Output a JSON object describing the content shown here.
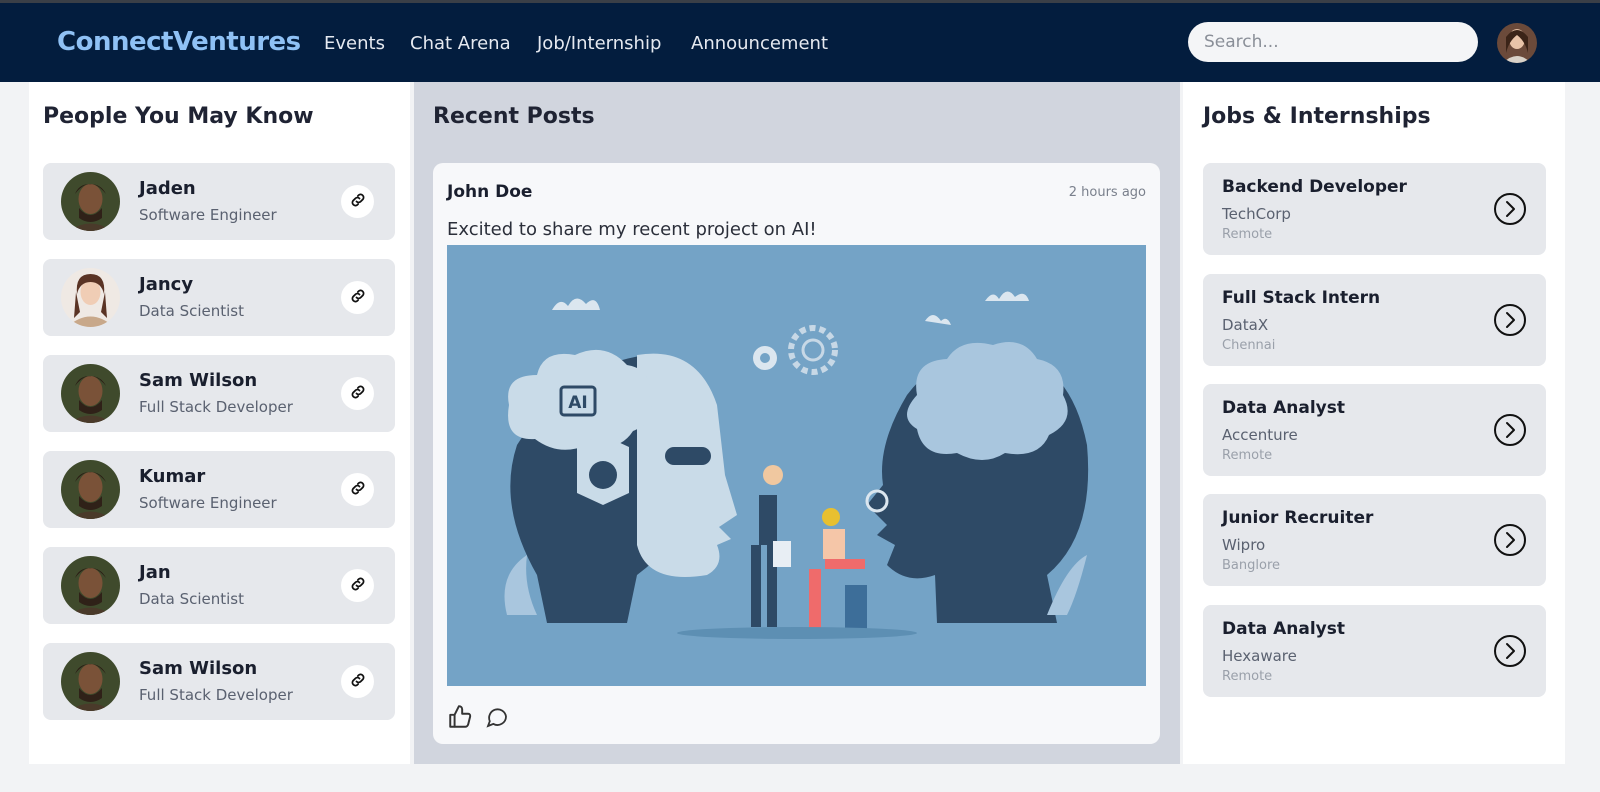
{
  "header": {
    "brand": "ConnectVentures",
    "nav": [
      "Events",
      "Chat Arena",
      "Job/Internship",
      "Announcement"
    ],
    "search_placeholder": "Search..."
  },
  "people": {
    "title": "People You May Know",
    "items": [
      {
        "name": "Jaden",
        "role": "Software Engineer"
      },
      {
        "name": "Jancy",
        "role": "Data Scientist"
      },
      {
        "name": "Sam Wilson",
        "role": "Full Stack Developer"
      },
      {
        "name": "Kumar",
        "role": "Software Engineer"
      },
      {
        "name": "Jan",
        "role": "Data Scientist"
      },
      {
        "name": "Sam Wilson",
        "role": "Full Stack Developer"
      }
    ]
  },
  "posts": {
    "title": "Recent Posts",
    "items": [
      {
        "author": "John Doe",
        "time": "2 hours ago",
        "text": "Excited to share my recent project on AI!",
        "image_label": "AI"
      }
    ]
  },
  "jobs": {
    "title": "Jobs & Internships",
    "items": [
      {
        "title": "Backend Developer",
        "company": "TechCorp",
        "location": "Remote"
      },
      {
        "title": "Full Stack Intern",
        "company": "DataX",
        "location": "Chennai"
      },
      {
        "title": "Data Analyst",
        "company": "Accenture",
        "location": "Remote"
      },
      {
        "title": "Junior Recruiter",
        "company": "Wipro",
        "location": "Banglore"
      },
      {
        "title": "Data Analyst",
        "company": "Hexaware",
        "location": "Remote"
      }
    ]
  },
  "colors": {
    "navbar": "#031d3e",
    "brand": "#8fc1f5",
    "post_image_bg": "#74a3c6"
  }
}
